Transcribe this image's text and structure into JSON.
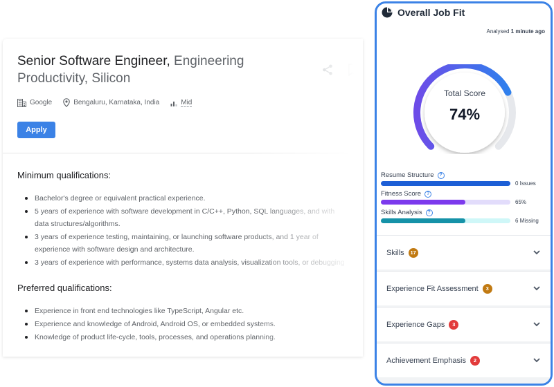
{
  "job": {
    "title_main": "Senior Software Engineer, ",
    "title_rest": "Engineering Productivity, Silicon",
    "company": "Google",
    "location": "Bengaluru, Karnataka, India",
    "level": "Mid",
    "apply_label": "Apply",
    "min_qual_title": "Minimum qualifications:",
    "min_quals": [
      "Bachelor's degree or equivalent practical experience.",
      "5 years of experience with software development in C/C++, Python, SQL languages, and with data structures/algorithms.",
      "3 years of experience testing, maintaining, or launching software products, and 1 year of experience with software design and architecture.",
      "3 years of experience with performance, systems data analysis, visualization tools, or debugging"
    ],
    "pref_qual_title": "Preferred qualifications:",
    "pref_quals": [
      "Experience in front end technologies like TypeScript, Angular etc.",
      "Experience and knowledge of Android, Android OS, or embedded systems.",
      "Knowledge of product life-cycle, tools, processes, and operations planning."
    ]
  },
  "fit": {
    "title": "Overall Job Fit",
    "analysed_prefix": "Analysed ",
    "analysed_time": "1 minute ago",
    "score_label": "Total Score",
    "score_value": "74%",
    "score_fraction": 0.74,
    "metrics": [
      {
        "label": "Resume Structure",
        "value": "0 Issues",
        "fraction": 1.0,
        "color": "#1d5fd6",
        "track": "#dbe6fb"
      },
      {
        "label": "Fitness Score",
        "value": "65%",
        "fraction": 0.65,
        "color": "#7c3aed",
        "track": "#e2dcfb"
      },
      {
        "label": "Skills Analysis",
        "value": "6 Missing",
        "fraction": 0.65,
        "color": "#1592a8",
        "track": "#cff7f8"
      }
    ],
    "sections": [
      {
        "label": "Skills",
        "badge": "17",
        "badge_color": "#c17a12"
      },
      {
        "label": "Experience Fit Assessment",
        "badge": "3",
        "badge_color": "#c17a12"
      },
      {
        "label": "Experience Gaps",
        "badge": "3",
        "badge_color": "#e23b3b"
      },
      {
        "label": "Achievement Emphasis",
        "badge": "2",
        "badge_color": "#e23b3b"
      }
    ]
  }
}
